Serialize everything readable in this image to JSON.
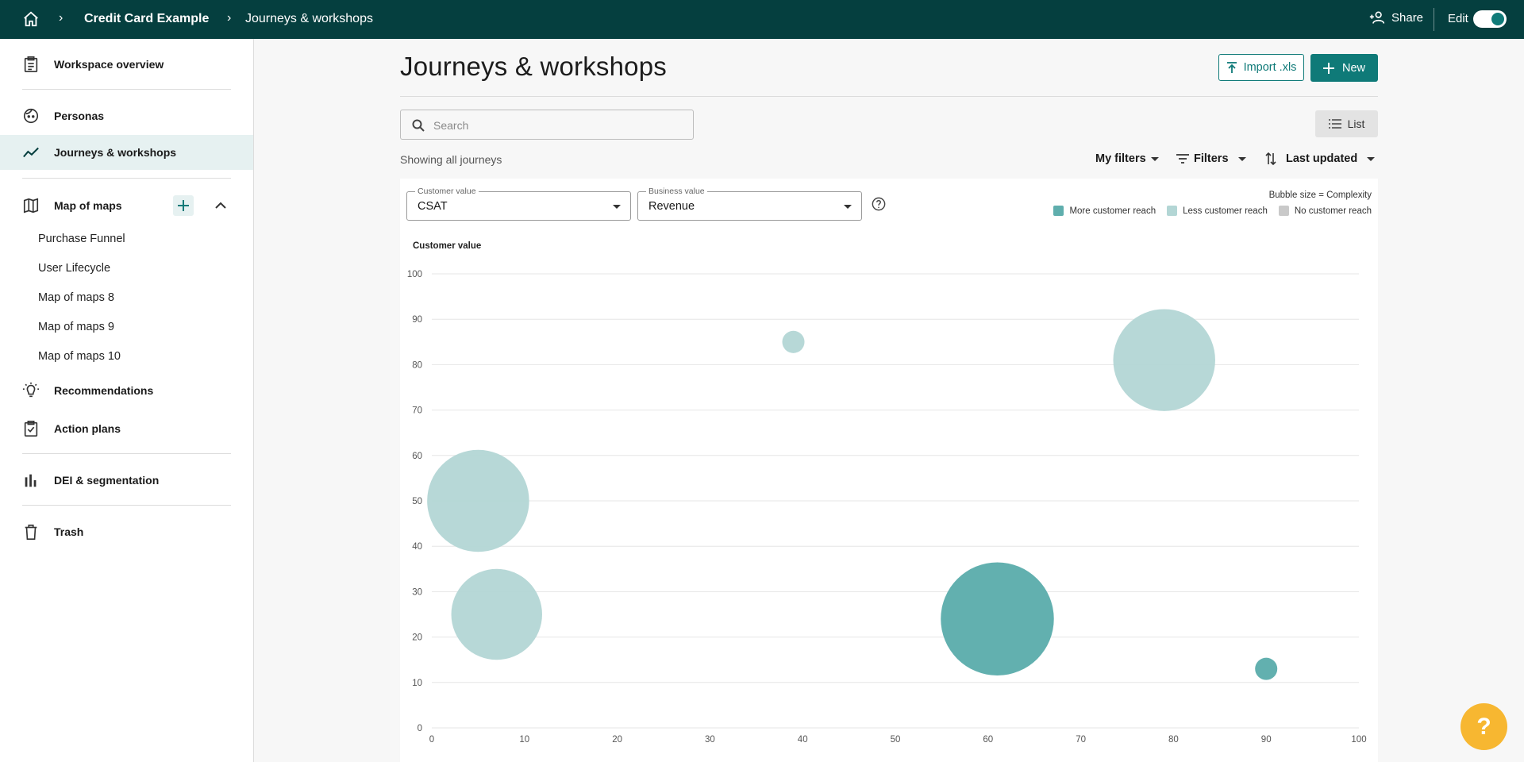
{
  "topbar": {
    "workspace": "Credit Card Example",
    "page": "Journeys & workshops",
    "share_label": "Share",
    "edit_label": "Edit",
    "edit_enabled": true,
    "bg_color": "#053f3f"
  },
  "sidebar": {
    "items": [
      {
        "label": "Workspace overview",
        "icon": "clipboard-icon"
      },
      {
        "label": "Personas",
        "icon": "face-icon"
      },
      {
        "label": "Journeys & workshops",
        "icon": "trend-line-icon",
        "active": true
      },
      {
        "label": "Map of maps",
        "icon": "map-icon"
      },
      {
        "label": "Recommendations",
        "icon": "lightbulb-icon"
      },
      {
        "label": "Action plans",
        "icon": "checkbox-clipboard-icon"
      },
      {
        "label": "DEI & segmentation",
        "icon": "bar-chart-icon"
      },
      {
        "label": "Trash",
        "icon": "trash-icon"
      }
    ],
    "map_children": [
      "Purchase Funnel",
      "User Lifecycle",
      "Map of maps 8",
      "Map of maps 9",
      "Map of maps 10"
    ]
  },
  "main": {
    "title": "Journeys & workshops",
    "import_label": "Import .xls",
    "new_label": "New",
    "search_placeholder": "Search",
    "list_label": "List",
    "showing_text": "Showing all journeys",
    "my_filters_label": "My filters",
    "filters_label": "Filters",
    "sort_label": "Last updated"
  },
  "chart_controls": {
    "customer_value_label": "Customer value",
    "customer_value": "CSAT",
    "business_value_label": "Business value",
    "business_value": "Revenue",
    "bubble_note": "Bubble size = Complexity",
    "legend": [
      {
        "label": "More customer reach",
        "color": "#5faead"
      },
      {
        "label": "Less customer reach",
        "color": "#b3d6d5"
      },
      {
        "label": "No customer reach",
        "color": "#c9c9c9"
      }
    ]
  },
  "chart_data": {
    "type": "scatter",
    "ylabel": "Customer value",
    "xlim": [
      0,
      100
    ],
    "ylim": [
      0,
      100
    ],
    "x_ticks": [
      0,
      10,
      20,
      30,
      40,
      50,
      60,
      70,
      80,
      90,
      100
    ],
    "y_ticks": [
      0,
      10,
      20,
      30,
      40,
      50,
      60,
      70,
      80,
      90,
      100
    ],
    "grid": true,
    "points": [
      {
        "x": 39,
        "y": 85,
        "size": 1.2,
        "reach": "less"
      },
      {
        "x": 79,
        "y": 81,
        "size": 5.5,
        "reach": "less"
      },
      {
        "x": 5,
        "y": 50,
        "size": 5.5,
        "reach": "less"
      },
      {
        "x": 7,
        "y": 25,
        "size": 4.9,
        "reach": "less"
      },
      {
        "x": 61,
        "y": 24,
        "size": 6.1,
        "reach": "more"
      },
      {
        "x": 90,
        "y": 13,
        "size": 1.2,
        "reach": "more"
      }
    ]
  },
  "help_fab": "?"
}
